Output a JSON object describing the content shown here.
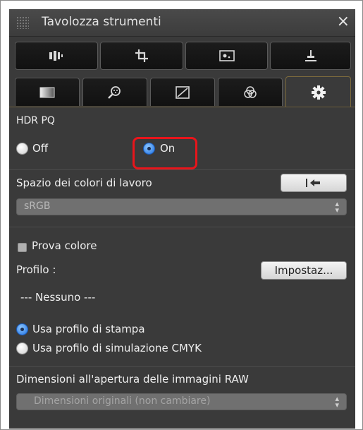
{
  "window": {
    "title": "Tavolozza strumenti",
    "close_glyph": "×"
  },
  "tabs_row1": [
    "adjust-levels-icon",
    "crop-icon",
    "image-dust-icon",
    "stamp-icon"
  ],
  "tabs_row2": [
    "image-quality-icon",
    "color-eyedropper-icon",
    "tone-curve-icon",
    "color-balance-icon",
    "settings-gear-icon"
  ],
  "active_tab": "settings-gear-icon",
  "hdr": {
    "heading": "HDR PQ",
    "off_label": "Off",
    "on_label": "On",
    "selected": "On"
  },
  "workspace": {
    "heading": "Spazio dei colori di lavoro",
    "reset_button_icon": "reset-arrow-icon",
    "value": "sRGB"
  },
  "proof": {
    "checkbox_label": "Prova colore",
    "profile_label": "Profilo :",
    "settings_button": "Impostaz...",
    "profile_value": "---  Nessuno  ---",
    "option_print": "Usa profilo di stampa",
    "option_cmyk": "Usa profilo di simulazione CMYK",
    "selected": "Usa profilo di stampa"
  },
  "raw": {
    "heading": "Dimensioni all'apertura delle immagini RAW",
    "value": "Dimensioni originali (non cambiare)"
  },
  "colors": {
    "highlight": "#e8151b",
    "accent_blue": "#1d6fe0",
    "panel_bg": "#3a3a3a"
  }
}
